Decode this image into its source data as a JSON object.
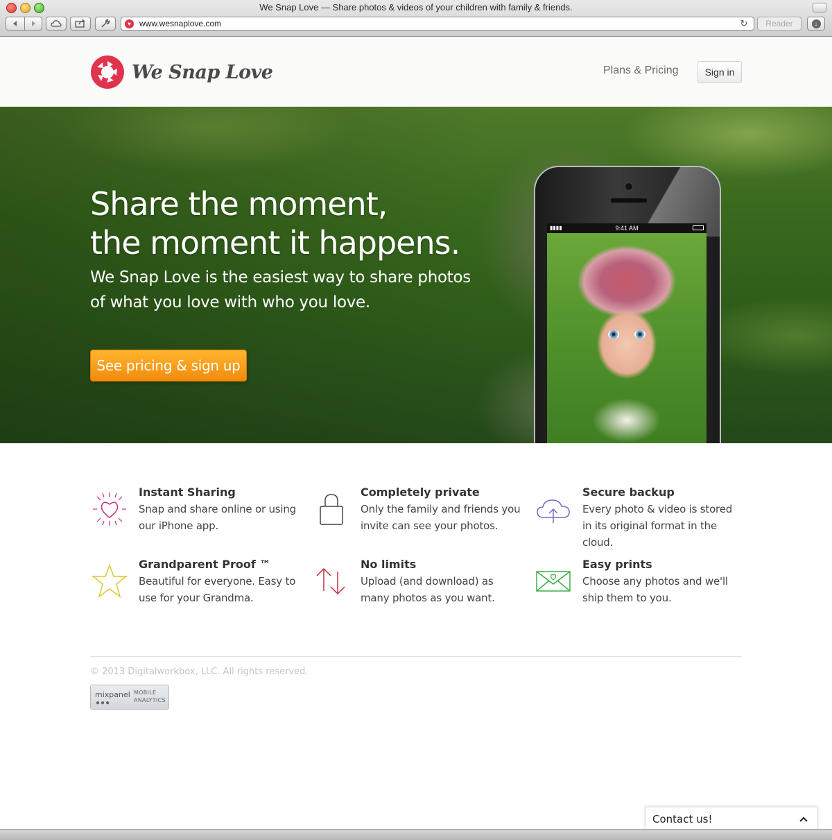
{
  "window": {
    "title": "We Snap Love — Share photos & videos of your children with family & friends."
  },
  "browser": {
    "url": "www.wesnaplove.com",
    "reader_label": "Reader"
  },
  "header": {
    "logo_text": "We Snap Love",
    "nav_pricing": "Plans & Pricing",
    "signin_label": "Sign in"
  },
  "hero": {
    "headline_line1": "Share the moment,",
    "headline_line2": "the moment it happens.",
    "sub_line1": "We Snap Love is the easiest way to share photos",
    "sub_line2": "of what you love with who you love.",
    "cta_label": "See pricing & sign up",
    "phone_time": "9:41 AM"
  },
  "features": [
    {
      "icon": "heart-share-icon",
      "title": "Instant Sharing",
      "desc": "Snap and share online or using our iPhone app.",
      "color": "#c8306a"
    },
    {
      "icon": "lock-icon",
      "title": "Completely private",
      "desc": "Only the family and friends you invite can see your photos.",
      "color": "#444444"
    },
    {
      "icon": "cloud-upload-icon",
      "title": "Secure backup",
      "desc": "Every photo & video is stored in its original format in the cloud.",
      "color": "#6d6fc4"
    },
    {
      "icon": "star-icon",
      "title": "Grandparent Proof ™",
      "desc": "Beautiful for everyone. Easy to use for your Grandma.",
      "color": "#e0c630"
    },
    {
      "icon": "up-down-arrows-icon",
      "title": "No limits",
      "desc": "Upload (and download) as many photos as you want.",
      "color": "#b8323e"
    },
    {
      "icon": "envelope-heart-icon",
      "title": "Easy prints",
      "desc": "Choose any photos and we'll ship them to you.",
      "color": "#3fae4a"
    }
  ],
  "footer": {
    "copyright": "© 2013 Digitalworkbox, LLC. All rights reserved.",
    "mixpanel_name": "mixpanel",
    "mixpanel_mobile": "MOBILE",
    "mixpanel_analytics": "ANALYTICS"
  },
  "contact": {
    "label": "Contact us!"
  },
  "colors": {
    "brand": "#e0334e",
    "cta": "#f5a01d"
  }
}
